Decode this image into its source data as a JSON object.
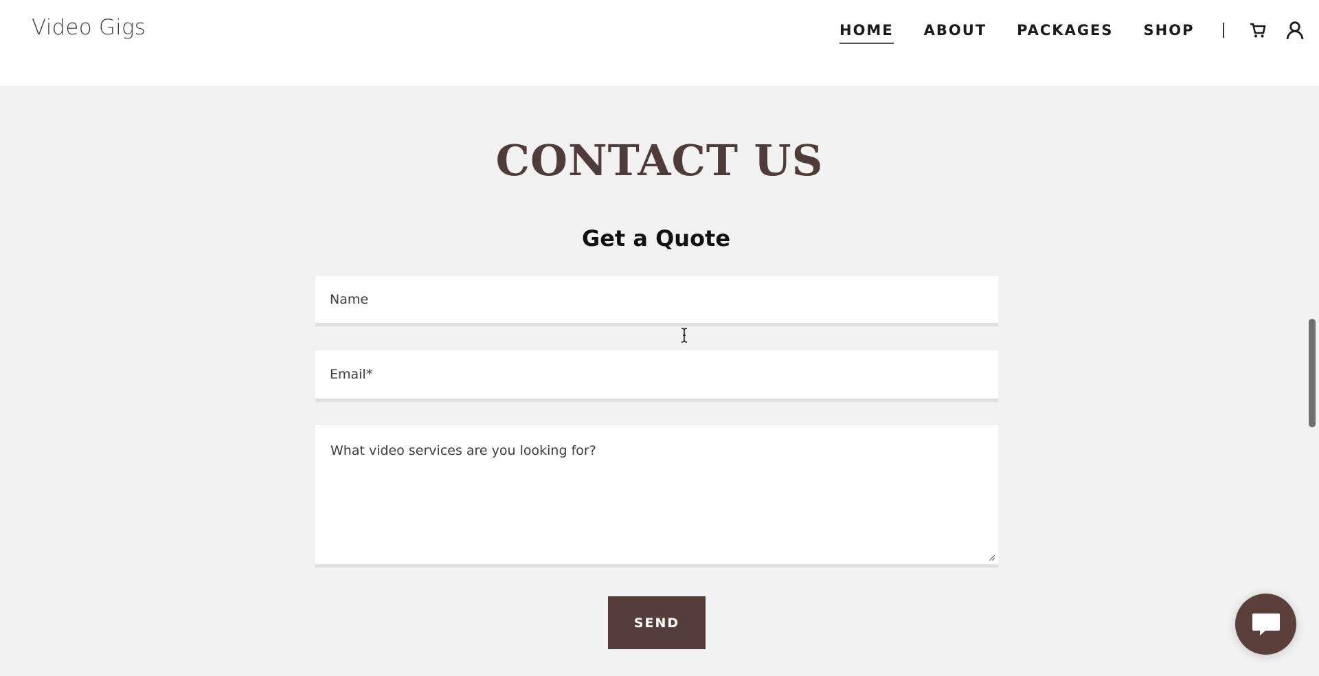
{
  "header": {
    "logo": "Video Gigs",
    "nav": [
      {
        "label": "HOME",
        "active": true
      },
      {
        "label": "ABOUT",
        "active": false
      },
      {
        "label": "PACKAGES",
        "active": false
      },
      {
        "label": "SHOP",
        "active": false
      }
    ],
    "icons": [
      "cart-icon",
      "account-icon"
    ]
  },
  "main": {
    "title": "CONTACT US",
    "subtitle": "Get a Quote",
    "form": {
      "name_placeholder": "Name",
      "email_placeholder": "Email*",
      "message_placeholder": "What video services are you looking for?",
      "send_label": "SEND"
    }
  },
  "chat": {
    "icon": "chat-icon"
  },
  "colors": {
    "accent": "#553d39",
    "title": "#4e3c3a",
    "background": "#f3f2f2"
  }
}
